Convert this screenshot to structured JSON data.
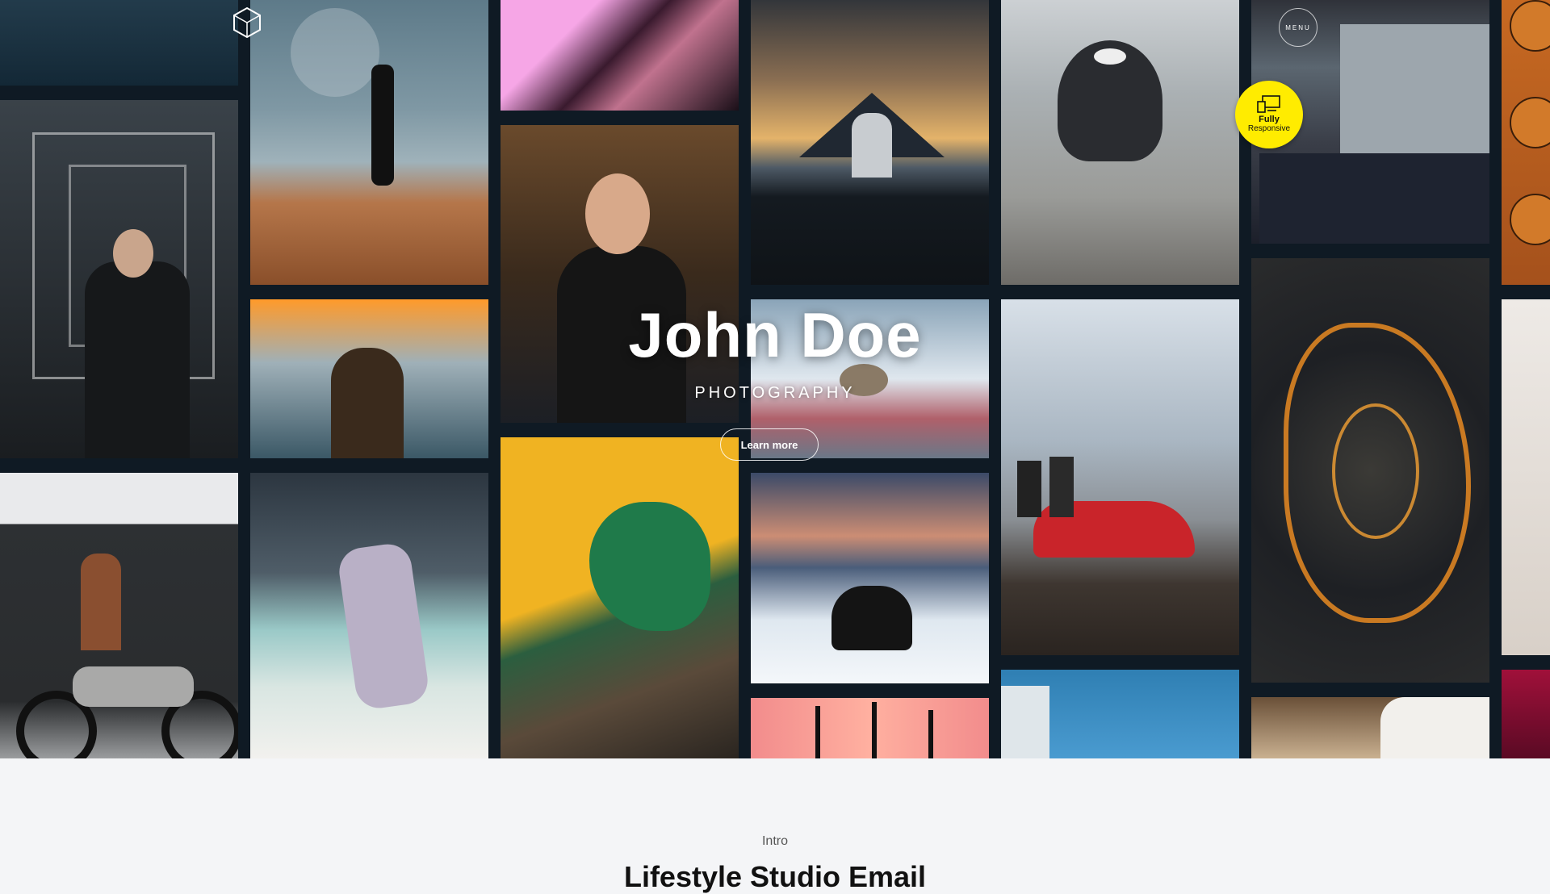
{
  "header": {
    "logo_icon": "hexagon-logo-icon",
    "menu_label": "MENU"
  },
  "badge": {
    "icon": "devices-icon",
    "line1": "Fully",
    "line2": "Responsive",
    "color": "#ffec00"
  },
  "hero": {
    "title": "John Doe",
    "subtitle": "PHOTOGRAPHY",
    "button_label": "Learn more",
    "background": "#0f1a24"
  },
  "gallery": {
    "photos": [
      "sneakers",
      "man-in-light-tunnel",
      "motorcyclist",
      "man-on-dune-with-moon",
      "woman-neon-light",
      "woman-on-beach",
      "pink-building",
      "woman-with-sunglasses",
      "chair-with-leaf",
      "man-facing-mountain",
      "bird-on-blossom",
      "dog-in-snow",
      "palm-trees",
      "dog-on-road",
      "red-sports-car",
      "building-sky",
      "person-with-laptop",
      "city-aerial-night",
      "room-interior",
      "basketballs",
      "woman-sitting",
      "magenta-abstract"
    ]
  },
  "intro": {
    "label": "Intro",
    "heading": "Lifestyle Studio Email"
  }
}
